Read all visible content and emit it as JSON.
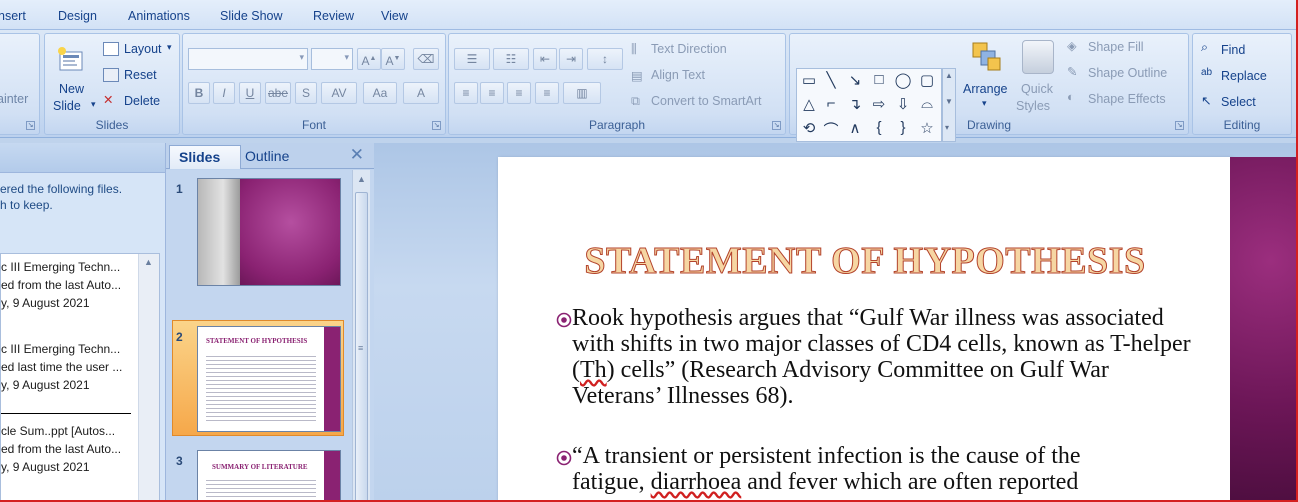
{
  "menu": {
    "tabs": [
      "nsert",
      "Design",
      "Animations",
      "Slide Show",
      "Review",
      "View"
    ]
  },
  "ribbon": {
    "clipboard": {
      "partial": "ainter"
    },
    "slides": {
      "title": "Slides",
      "new_slide": [
        "New",
        "Slide"
      ],
      "layout": "Layout",
      "reset": "Reset",
      "delete": "Delete"
    },
    "font": {
      "title": "Font",
      "buttons": [
        "B",
        "I",
        "U",
        "abe",
        "S",
        "AV",
        "Aa",
        "A"
      ]
    },
    "paragraph": {
      "title": "Paragraph",
      "text_direction": "Text Direction",
      "align_text": "Align Text",
      "convert": "Convert to SmartArt"
    },
    "drawing": {
      "title": "Drawing",
      "arrange": "Arrange",
      "quick_styles": [
        "Quick",
        "Styles"
      ],
      "shape_fill": "Shape Fill",
      "shape_outline": "Shape Outline",
      "shape_effects": "Shape Effects"
    },
    "editing": {
      "title": "Editing",
      "find": "Find",
      "replace": "Replace",
      "select": "Select"
    }
  },
  "recovery": {
    "message": [
      "ered the following files.",
      "h to keep."
    ],
    "files": [
      {
        "name": "c III Emerging Techn...",
        "desc": "ed from the last Auto...",
        "date": "y, 9 August 2021"
      },
      {
        "name": "c III Emerging Techn...",
        "desc": "ed last time the user ...",
        "date": "y, 9 August 2021"
      },
      {
        "name": "cle Sum..ppt  [Autos...",
        "desc": "ed from the last Auto...",
        "date": "y, 9 August 2021"
      }
    ]
  },
  "slides_pane": {
    "tab_slides": "Slides",
    "tab_outline": "Outline",
    "close": "✕",
    "numbers": [
      "1",
      "2",
      "3"
    ],
    "thumb_titles": [
      "STATEMENT OF HYPOTHESIS",
      "SUMMARY OF LITERATURE"
    ]
  },
  "slide": {
    "title": "STATEMENT OF HYPOTHESIS",
    "bullet1": {
      "before": "Rook hypothesis argues that “Gulf War illness was associated with shifts in two major classes of CD4 cells, known as T-helper (",
      "squiggle": "Th",
      "after": ") cells” (Research Advisory Committee on Gulf War Veterans’ Illnesses 68)."
    },
    "bullet2": {
      "line1": "“A transient or persistent infection is the cause of the",
      "line2_before": "fatigue, ",
      "line2_squiggle": "diarrhoea",
      "line2_after": " and fever which are often reported"
    }
  },
  "colors": {
    "ribbon_text": "#15428b",
    "accent_magenta": "#8a2272",
    "title_fill": "#f6d6a3",
    "title_stroke": "#b3432c",
    "selection": "#f6a84a"
  }
}
